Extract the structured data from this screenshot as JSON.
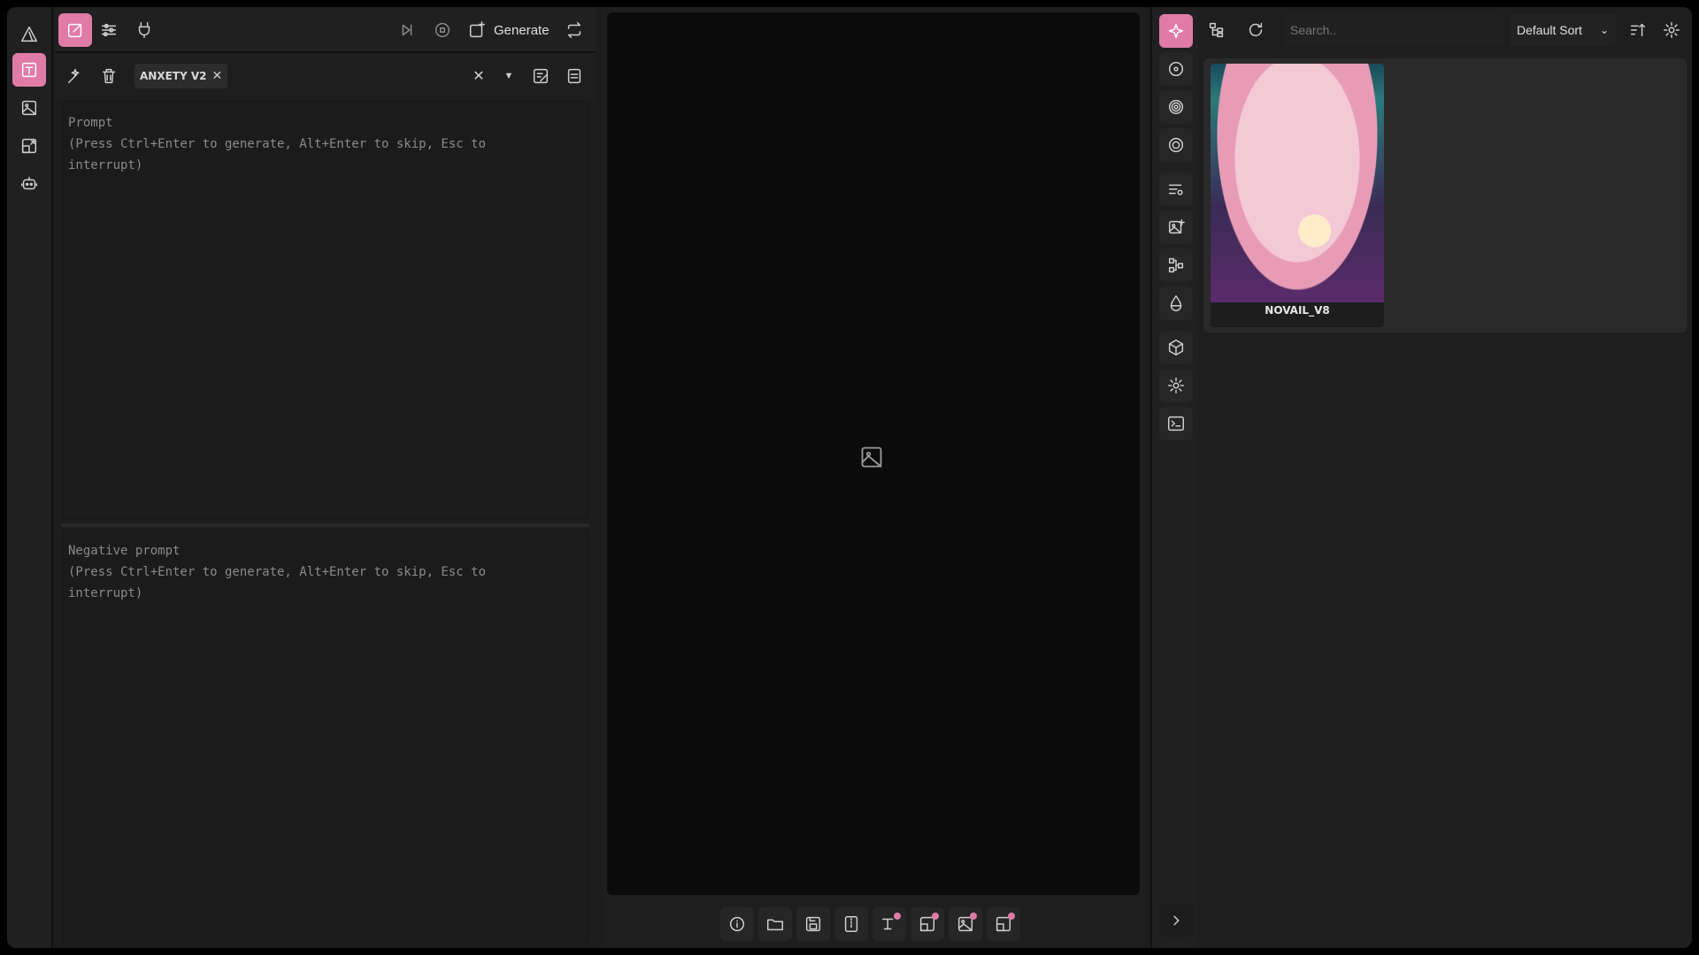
{
  "left_rail": {
    "items": [
      {
        "name": "logo-icon"
      },
      {
        "name": "text-to-image-icon",
        "active": true
      },
      {
        "name": "image-icon"
      },
      {
        "name": "resize-icon"
      },
      {
        "name": "bot-icon"
      }
    ]
  },
  "toolbar": {
    "generate_label": "Generate"
  },
  "styles": {
    "selected_chip": "ANXETY V2"
  },
  "prompt": {
    "placeholder": "Prompt\n(Press Ctrl+Enter to generate, Alt+Enter to skip, Esc to\ninterrupt)",
    "value": ""
  },
  "negative_prompt": {
    "placeholder": "Negative prompt\n(Press Ctrl+Enter to generate, Alt+Enter to skip, Esc to\ninterrupt)",
    "value": ""
  },
  "gallery": {
    "search_placeholder": "Search..",
    "sort_label": "Default Sort",
    "items": [
      {
        "label": "NOVAIL_V8"
      }
    ]
  },
  "colors": {
    "accent": "#e07ba7",
    "background": "#1c1c1c",
    "canvas": "#0b0b0b"
  }
}
